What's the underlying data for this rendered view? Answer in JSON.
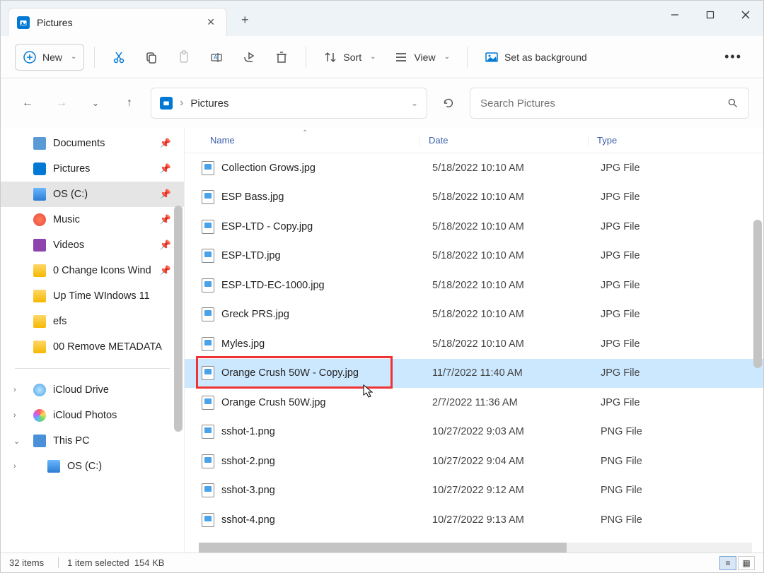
{
  "tab": {
    "title": "Pictures"
  },
  "toolbar": {
    "new": "New",
    "sort": "Sort",
    "view": "View",
    "set_bg": "Set as background"
  },
  "address": {
    "location": "Pictures"
  },
  "search": {
    "placeholder": "Search Pictures"
  },
  "sidebar": {
    "items": [
      {
        "label": "Documents",
        "icon": "doc-ic",
        "pinned": true
      },
      {
        "label": "Pictures",
        "icon": "pic-ic",
        "pinned": true
      },
      {
        "label": "OS (C:)",
        "icon": "drive-ic",
        "pinned": true,
        "selected": true
      },
      {
        "label": "Music",
        "icon": "music-ic",
        "pinned": true
      },
      {
        "label": "Videos",
        "icon": "video-ic",
        "pinned": true
      },
      {
        "label": "0 Change Icons Wind",
        "icon": "folder-ic",
        "pinned": true
      },
      {
        "label": "Up Time WIndows 11",
        "icon": "folder-ic"
      },
      {
        "label": "efs",
        "icon": "folder-ic"
      },
      {
        "label": "00 Remove METADATA",
        "icon": "folder-ic"
      }
    ],
    "lower": [
      {
        "label": "iCloud Drive",
        "icon": "cloud-ic",
        "exp": "›"
      },
      {
        "label": "iCloud Photos",
        "icon": "photos-ic",
        "exp": "›"
      },
      {
        "label": "This PC",
        "icon": "pc-ic",
        "exp": "⌄"
      },
      {
        "label": "OS (C:)",
        "icon": "drive-ic",
        "exp": "›",
        "indent": true
      }
    ]
  },
  "columns": {
    "name": "Name",
    "date": "Date",
    "type": "Type"
  },
  "files": [
    {
      "name": "Collection Grows.jpg",
      "date": "5/18/2022 10:10 AM",
      "type": "JPG File"
    },
    {
      "name": "ESP Bass.jpg",
      "date": "5/18/2022 10:10 AM",
      "type": "JPG File"
    },
    {
      "name": "ESP-LTD - Copy.jpg",
      "date": "5/18/2022 10:10 AM",
      "type": "JPG File"
    },
    {
      "name": "ESP-LTD.jpg",
      "date": "5/18/2022 10:10 AM",
      "type": "JPG File"
    },
    {
      "name": "ESP-LTD-EC-1000.jpg",
      "date": "5/18/2022 10:10 AM",
      "type": "JPG File"
    },
    {
      "name": "Greck PRS.jpg",
      "date": "5/18/2022 10:10 AM",
      "type": "JPG File"
    },
    {
      "name": "Myles.jpg",
      "date": "5/18/2022 10:10 AM",
      "type": "JPG File"
    },
    {
      "name": "Orange Crush 50W - Copy.jpg",
      "date": "11/7/2022 11:40 AM",
      "type": "JPG File",
      "selected": true,
      "highlight": true
    },
    {
      "name": "Orange Crush 50W.jpg",
      "date": "2/7/2022 11:36 AM",
      "type": "JPG File"
    },
    {
      "name": "sshot-1.png",
      "date": "10/27/2022 9:03 AM",
      "type": "PNG File"
    },
    {
      "name": "sshot-2.png",
      "date": "10/27/2022 9:04 AM",
      "type": "PNG File"
    },
    {
      "name": "sshot-3.png",
      "date": "10/27/2022 9:12 AM",
      "type": "PNG File"
    },
    {
      "name": "sshot-4.png",
      "date": "10/27/2022 9:13 AM",
      "type": "PNG File"
    }
  ],
  "status": {
    "count": "32 items",
    "selection": "1 item selected",
    "size": "154 KB"
  }
}
